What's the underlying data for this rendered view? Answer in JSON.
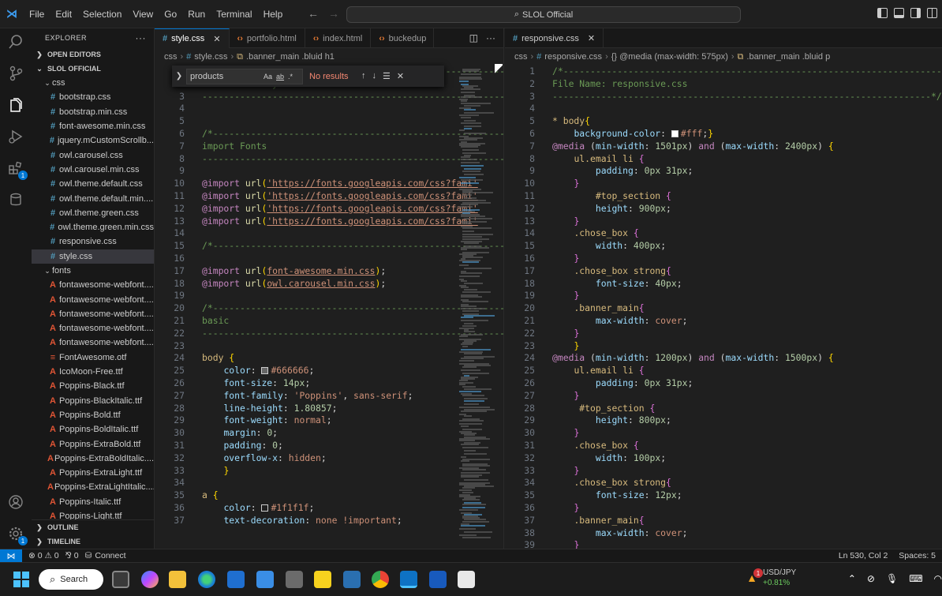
{
  "titlebar": {
    "menus": [
      "File",
      "Edit",
      "Selection",
      "View",
      "Go",
      "Run",
      "Terminal",
      "Help"
    ],
    "search_label": "SLOL Official"
  },
  "explorer": {
    "title": "EXPLORER",
    "open_editors": "OPEN EDITORS",
    "root": "SLOL OFFICIAL",
    "css_folder": "css",
    "css_files": [
      "bootstrap.css",
      "bootstrap.min.css",
      "font-awesome.min.css",
      "jquery.mCustomScrollb...",
      "owl.carousel.css",
      "owl.carousel.min.css",
      "owl.theme.default.css",
      "owl.theme.default.min....",
      "owl.theme.green.css",
      "owl.theme.green.min.css",
      "responsive.css",
      "style.css"
    ],
    "fonts_folder": "fonts",
    "font_files": [
      "fontawesome-webfont....",
      "fontawesome-webfont....",
      "fontawesome-webfont....",
      "fontawesome-webfont....",
      "fontawesome-webfont....",
      "FontAwesome.otf",
      "IcoMoon-Free.ttf",
      "Poppins-Black.ttf",
      "Poppins-BlackItalic.ttf",
      "Poppins-Bold.ttf",
      "Poppins-BoldItalic.ttf",
      "Poppins-ExtraBold.ttf",
      "Poppins-ExtraBoldItalic....",
      "Poppins-ExtraLight.ttf",
      "Poppins-ExtraLightItalic....",
      "Poppins-Italic.ttf",
      "Poppins-Light.ttf"
    ],
    "outline": "OUTLINE",
    "timeline": "TIMELINE"
  },
  "editor1": {
    "tabs": [
      "style.css",
      "portfolio.html",
      "index.html",
      "buckedup"
    ],
    "breadcrumb": [
      "css",
      "style.css",
      ".banner_main .bluid h1"
    ],
    "find": {
      "value": "products",
      "result": "No results"
    }
  },
  "editor2": {
    "tabs": [
      "responsive.css"
    ],
    "breadcrumb": [
      "css",
      "responsive.css",
      "{} @media (max-width: 575px)",
      ".banner_main .bluid p"
    ]
  },
  "statusbar": {
    "problems": "⊗ 0 ⚠ 0",
    "ports": "⅋ 0",
    "connect": "Connect",
    "position": "Ln 530, Col 2",
    "spaces": "Spaces: 5"
  },
  "taskbar": {
    "search": "Search",
    "ticker_name": "USD/JPY",
    "ticker_change": "+0.81%",
    "ticker_badge": "1"
  }
}
